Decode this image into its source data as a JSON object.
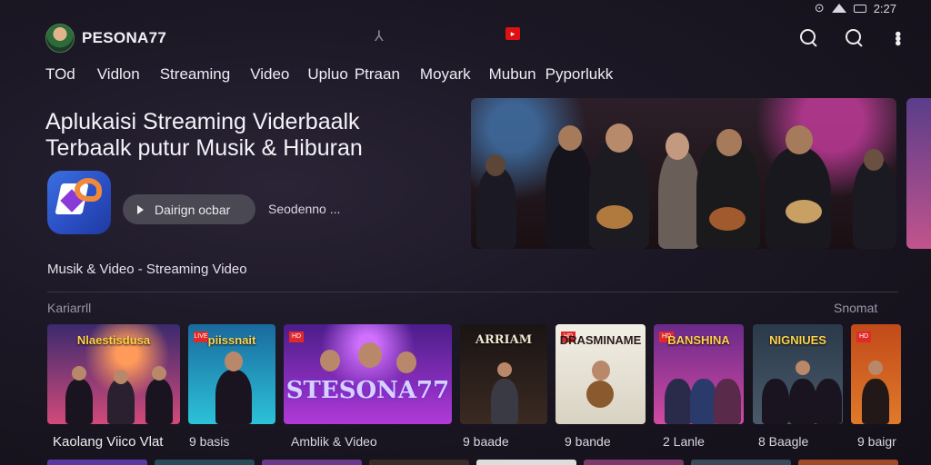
{
  "status_bar": {
    "time": "2:27"
  },
  "header": {
    "app_name": "PESONA77"
  },
  "nav": {
    "tabs": [
      "TOd",
      "Vidlon",
      "Streaming",
      "Video",
      "Upluo",
      "Ptraan",
      "Moyark",
      "Mubun",
      "Pyporlukk"
    ]
  },
  "hero": {
    "title": "Aplukaisi Streaming Viderbaalk Terbaalk putur Musik & Hiburan",
    "button_label": "Dairign ocbar",
    "more_label": "Seodenno ...",
    "subtitle": "Musik & Video - Streaming Video"
  },
  "section": {
    "label": "Kariarrll",
    "more": "Snomat"
  },
  "cards": [
    {
      "title": "Nlaestisdusa",
      "label": "Kaolang Viico Vlat",
      "colors": [
        "#3b2a6e",
        "#d24a7a"
      ]
    },
    {
      "title": "piissnait",
      "label": "9 basis",
      "colors": [
        "#1a6a9e",
        "#2cc2d9"
      ]
    },
    {
      "title": "STESONA77",
      "label": "Amblik & Video",
      "colors": [
        "#4b1d8a",
        "#b03ad8"
      ]
    },
    {
      "title": "ARRIAM",
      "label": "9 baade",
      "colors": [
        "#1a1414",
        "#3a2a22"
      ]
    },
    {
      "title": "DRASMINAME",
      "label": "9 bande",
      "colors": [
        "#f2efe6",
        "#d8d2c2"
      ]
    },
    {
      "title": "BANSHINA",
      "label": "2 Lanle",
      "colors": [
        "#6a2a8a",
        "#d24aa2"
      ]
    },
    {
      "title": "NIGNIUES",
      "label": "8 Baagle",
      "colors": [
        "#2a3a4a",
        "#4a5a6a"
      ]
    },
    {
      "title": "",
      "label": "9 baigr",
      "colors": [
        "#c24a1a",
        "#e07a2a"
      ]
    }
  ]
}
